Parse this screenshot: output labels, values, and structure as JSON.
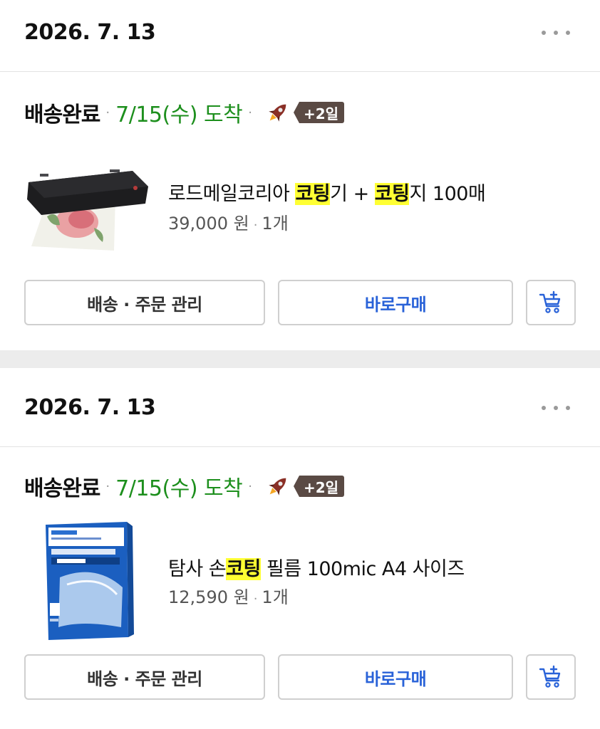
{
  "orders": [
    {
      "date": "2026. 7. 13",
      "status": "배송완료",
      "arrival": "7/15(수) 도착",
      "extra_days": "+2일",
      "product": {
        "name_parts": [
          "로드메일코리아 ",
          "코팅",
          "기 + ",
          "코팅",
          "지 100매"
        ],
        "price": "39,000 원",
        "qty": "1개"
      },
      "buttons": {
        "manage": "배송 · 주문 관리",
        "buy": "바로구매"
      }
    },
    {
      "date": "2026. 7. 13",
      "status": "배송완료",
      "arrival": "7/15(수) 도착",
      "extra_days": "+2일",
      "product": {
        "name_parts": [
          "탐사 손",
          "코팅",
          " 필름 100mic A4 사이즈"
        ],
        "price": "12,590 원",
        "qty": "1개"
      },
      "buttons": {
        "manage": "배송 · 주문 관리",
        "buy": "바로구매"
      }
    }
  ],
  "icons": {
    "more": "more-horizontal-icon",
    "rocket": "rocket-icon",
    "cart": "cart-add-icon"
  },
  "colors": {
    "arrival_green": "#1d8f1d",
    "buy_blue": "#2962d8",
    "highlight": "#ffff33",
    "badge_brown": "#5a4a44"
  }
}
